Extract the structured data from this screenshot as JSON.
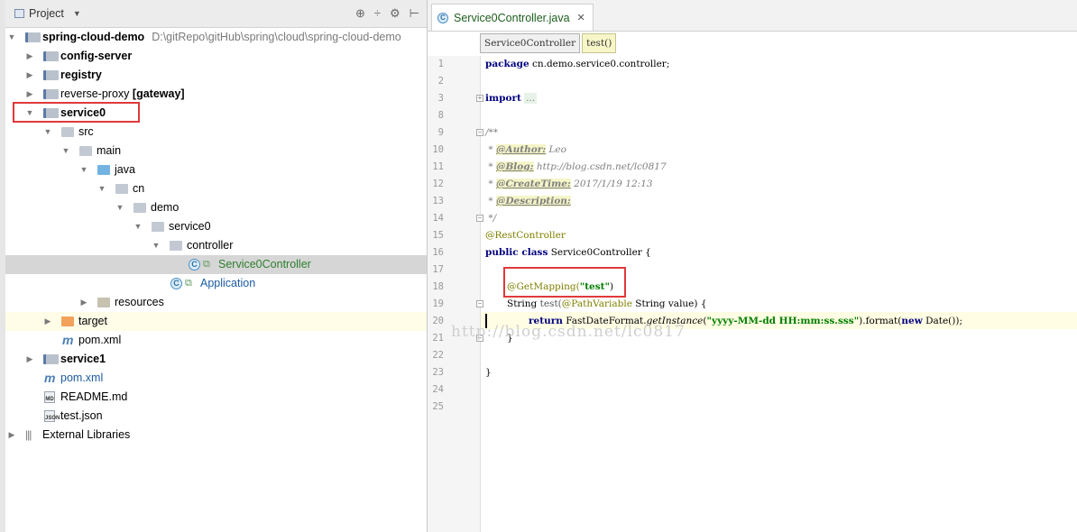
{
  "project_panel": {
    "title": "Project",
    "tools": [
      "⊕",
      "÷",
      "⚙",
      "⊢"
    ],
    "tree": [
      {
        "label": "spring-cloud-demo",
        "path": "D:\\gitRepo\\gitHub\\spring\\cloud\\spring-cloud-demo"
      },
      {
        "label": "config-server"
      },
      {
        "label": "registry"
      },
      {
        "label": "reverse-proxy",
        "suffix": "[gateway]"
      },
      {
        "label": "service0"
      },
      {
        "label": "src"
      },
      {
        "label": "main"
      },
      {
        "label": "java"
      },
      {
        "label": "cn"
      },
      {
        "label": "demo"
      },
      {
        "label": "service0"
      },
      {
        "label": "controller"
      },
      {
        "label": "Service0Controller"
      },
      {
        "label": "Application"
      },
      {
        "label": "resources"
      },
      {
        "label": "target"
      },
      {
        "label": "pom.xml"
      },
      {
        "label": "service1"
      },
      {
        "label": "pom.xml"
      },
      {
        "label": "README.md"
      },
      {
        "label": "test.json"
      },
      {
        "label": "External Libraries"
      }
    ],
    "file_badges": {
      "md": "MD",
      "json": "JSON"
    }
  },
  "editor": {
    "tab_label": "Service0Controller.java",
    "tab_close": "✕",
    "breadcrumbs": [
      "Service0Controller",
      "test()"
    ],
    "line_numbers": [
      "1",
      "2",
      "3",
      "8",
      "9",
      "10",
      "11",
      "12",
      "13",
      "14",
      "15",
      "16",
      "17",
      "18",
      "19",
      "20",
      "21",
      "22",
      "23",
      "24",
      "25"
    ],
    "code": {
      "l1_kw": "package",
      "l1_rest": " cn.demo.service0.controller;",
      "l3_kw": "import",
      "l3_dots": "...",
      "l10": "/**",
      "l11_pre": " * ",
      "l11_tag": "@Author:",
      "l11_val": " Leo",
      "l12_pre": " * ",
      "l12_tag": "@Blog:",
      "l12_val": " http://blog.csdn.net/lc0817",
      "l13_pre": " * ",
      "l13_tag": "@CreateTime:",
      "l13_val": " 2017/1/19 12:13",
      "l14_pre": " * ",
      "l14_tag": "@Description:",
      "l15": " */",
      "l16": "@RestController",
      "l17_kw": "public class",
      "l17_rest": " Service0Controller {",
      "l19_ann": "@GetMapping(",
      "l19_str": "\"test\"",
      "l19_end": ")",
      "l20_a": "String ",
      "l20_b": "test(",
      "l20_ann": "@PathVariable",
      "l20_c": " String value) {",
      "l21_kw": "return",
      "l21_a": " FastDateFormat.",
      "l21_b": "getInstance",
      "l21_c": "(",
      "l21_str": "\"yyyy-MM-dd HH:mm:ss.sss\"",
      "l21_d": ").format(",
      "l21_kw2": "new",
      "l21_e": " Date());",
      "l22": "}",
      "l24": "}"
    },
    "watermark": "http://blog.csdn.net/lc0817"
  }
}
